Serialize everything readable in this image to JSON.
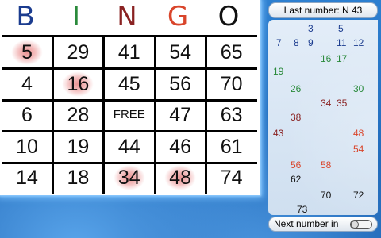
{
  "header": {
    "letters": [
      {
        "char": "B",
        "color": "#1b3c8f"
      },
      {
        "char": "I",
        "color": "#2a8a3b"
      },
      {
        "char": "N",
        "color": "#8a2222"
      },
      {
        "char": "G",
        "color": "#d9452b"
      },
      {
        "char": "O",
        "color": "#111111"
      }
    ]
  },
  "card": {
    "rows": [
      [
        "5",
        "29",
        "41",
        "54",
        "65"
      ],
      [
        "4",
        "16",
        "45",
        "56",
        "70"
      ],
      [
        "6",
        "28",
        "FREE",
        "47",
        "63"
      ],
      [
        "10",
        "19",
        "44",
        "46",
        "61"
      ],
      [
        "14",
        "18",
        "34",
        "48",
        "74"
      ]
    ],
    "marked": [
      "5",
      "16",
      "34",
      "48"
    ]
  },
  "panel": {
    "last_number_label": "Last number: N 43",
    "next_number_label": "Next number in",
    "called_numbers": [
      {
        "n": "3",
        "color": "#1b3c8f"
      },
      {
        "n": "5",
        "color": "#1b3c8f"
      },
      {
        "n": "7",
        "color": "#1b3c8f"
      },
      {
        "n": "8",
        "color": "#1b3c8f"
      },
      {
        "n": "9",
        "color": "#1b3c8f"
      },
      {
        "n": "11",
        "color": "#1b3c8f"
      },
      {
        "n": "12",
        "color": "#1b3c8f"
      },
      {
        "n": "16",
        "color": "#2a8a3b"
      },
      {
        "n": "17",
        "color": "#2a8a3b"
      },
      {
        "n": "19",
        "color": "#2a8a3b"
      },
      {
        "n": "26",
        "color": "#2a8a3b"
      },
      {
        "n": "30",
        "color": "#2a8a3b"
      },
      {
        "n": "34",
        "color": "#8a2222"
      },
      {
        "n": "35",
        "color": "#8a2222"
      },
      {
        "n": "38",
        "color": "#8a2222"
      },
      {
        "n": "43",
        "color": "#8a2222"
      },
      {
        "n": "48",
        "color": "#d9452b"
      },
      {
        "n": "54",
        "color": "#d9452b"
      },
      {
        "n": "56",
        "color": "#d9452b"
      },
      {
        "n": "58",
        "color": "#d9452b"
      },
      {
        "n": "62",
        "color": "#111111"
      },
      {
        "n": "70",
        "color": "#111111"
      },
      {
        "n": "72",
        "color": "#111111"
      },
      {
        "n": "73",
        "color": "#111111"
      }
    ]
  }
}
